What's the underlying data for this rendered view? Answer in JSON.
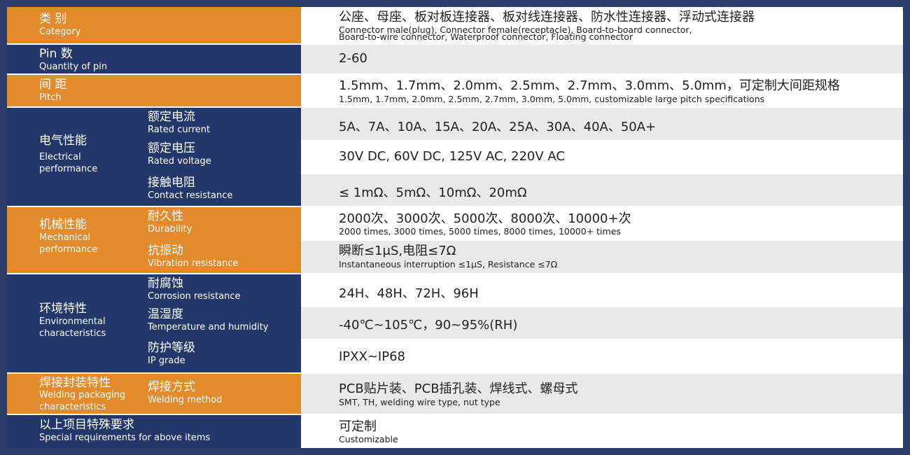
{
  "rows": {
    "category": {
      "cn": "类 别",
      "en": "Category",
      "value_cn": "公座、母座、板对板连接器、板对线连接器、防水性连接器、浮动式连接器",
      "value_en1": "Connector male(plug), Connector female(receptacle), Board-to-board connector,",
      "value_en2": "Board-to-wire connector, Waterproof connector, Floating connector"
    },
    "pins": {
      "cn": "Pin 数",
      "en": "Quantity of pin",
      "value": "2-60"
    },
    "pitch": {
      "cn": "间 距",
      "en": "Pitch",
      "value_cn": "1.5mm、1.7mm、2.0mm、2.5mm、2.7mm、3.0mm、5.0mm，可定制大间距规格",
      "value_en": "1.5mm, 1.7mm, 2.0mm, 2.5mm, 2.7mm, 3.0mm, 5.0mm, customizable large pitch specifications"
    },
    "electrical": {
      "cn": "电气性能",
      "en1": "Electrical",
      "en2": "performance",
      "current": {
        "cn": "额定电流",
        "en": "Rated current",
        "value": "5A、7A、10A、15A、20A、25A、30A、40A、50A+"
      },
      "voltage": {
        "cn": "额定电压",
        "en": "Rated voltage",
        "value": "30V DC, 60V DC, 125V AC, 220V AC"
      },
      "contact": {
        "cn": "接触电阻",
        "en": "Contact resistance",
        "value": "≤ 1mΩ、5mΩ、10mΩ、20mΩ"
      }
    },
    "mechanical": {
      "cn": "机械性能",
      "en1": "Mechanical",
      "en2": "performance",
      "durability": {
        "cn": "耐久性",
        "en": "Durability",
        "value_cn": "2000次、3000次、5000次、8000次、10000+次",
        "value_en": "2000 times, 3000 times, 5000 times, 8000 times, 10000+ times"
      },
      "vibration": {
        "cn": "抗振动",
        "en": "Vibration resistance",
        "value_cn": "瞬断≤1μS,电阻≤7Ω",
        "value_en": "Instantaneous interruption ≤1μS, Resistance ≤7Ω"
      }
    },
    "environmental": {
      "cn": "环境特性",
      "en1": "Environmental",
      "en2": "characteristics",
      "corrosion": {
        "cn": "耐腐蚀",
        "en": "Corrosion resistance",
        "value": "24H、48H、72H、96H"
      },
      "temperature": {
        "cn": "温湿度",
        "en": "Temperature and humidity",
        "value": "-40℃~105℃，90~95%(RH)"
      },
      "ip": {
        "cn": "防护等级",
        "en": "IP grade",
        "value": "IPXX~IP68"
      }
    },
    "welding": {
      "cn": "焊接封装特性",
      "en1": "Welding packaging",
      "en2": "characteristics",
      "method": {
        "cn": "焊接方式",
        "en": "Welding method",
        "value_cn": "PCB贴片装、PCB插孔装、焊线式、螺母式",
        "value_en": "SMT, TH, welding wire type, nut type"
      }
    },
    "special": {
      "cn": "以上项目特殊要求",
      "en": "Special requirements for above items",
      "value_cn": "可定制",
      "value_en": "Customizable"
    }
  },
  "colors": {
    "orange": "#e38a2c",
    "navy": "#22386a",
    "grey": "#e9e9ea",
    "border": "#2a3d6b"
  }
}
